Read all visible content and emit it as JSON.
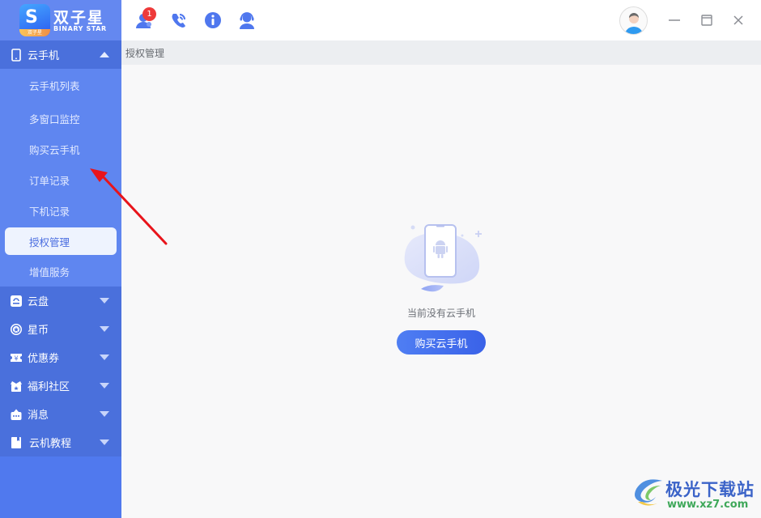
{
  "app": {
    "brand_cn": "双子星",
    "brand_en": "BINARY STAR",
    "brand_ribbon": "双子星"
  },
  "topbar": {
    "icons": [
      {
        "name": "contacts-icon",
        "badge": "1"
      },
      {
        "name": "phone-support-icon"
      },
      {
        "name": "info-icon"
      },
      {
        "name": "customer-service-icon"
      }
    ],
    "window_controls": [
      "minimize",
      "maximize",
      "close"
    ]
  },
  "sidebar": {
    "groups": [
      {
        "label": "云手机",
        "icon": "phone-icon",
        "expanded": true,
        "items": [
          {
            "label": "云手机列表",
            "active": false
          },
          {
            "label": "多窗口监控",
            "active": false
          },
          {
            "label": "购买云手机",
            "active": false
          },
          {
            "label": "订单记录",
            "active": false
          },
          {
            "label": "下机记录",
            "active": false
          },
          {
            "label": "授权管理",
            "active": true
          },
          {
            "label": "增值服务",
            "active": false
          }
        ]
      },
      {
        "label": "云盘",
        "icon": "cloud-disk-icon",
        "expanded": false
      },
      {
        "label": "星币",
        "icon": "star-coin-icon",
        "expanded": false
      },
      {
        "label": "优惠券",
        "icon": "coupon-icon",
        "expanded": false
      },
      {
        "label": "福利社区",
        "icon": "gift-icon",
        "expanded": false
      },
      {
        "label": "消息",
        "icon": "message-icon",
        "expanded": false
      },
      {
        "label": "云机教程",
        "icon": "tutorial-book-icon",
        "expanded": false
      }
    ]
  },
  "breadcrumb": "授权管理",
  "main": {
    "empty_text": "当前没有云手机",
    "buy_button": "购买云手机"
  },
  "watermark": {
    "name": "极光下载站",
    "url": "www.xz7.com"
  },
  "colors": {
    "sidebar": "#5079ee",
    "sidebar_group": "#4a70dc",
    "sidebar_sub": "#5f86f0",
    "active_item_bg": "#eef3fe",
    "accent": "#4a6de0",
    "badge": "#ee3a3a",
    "annotation_arrow": "#e8141b"
  }
}
